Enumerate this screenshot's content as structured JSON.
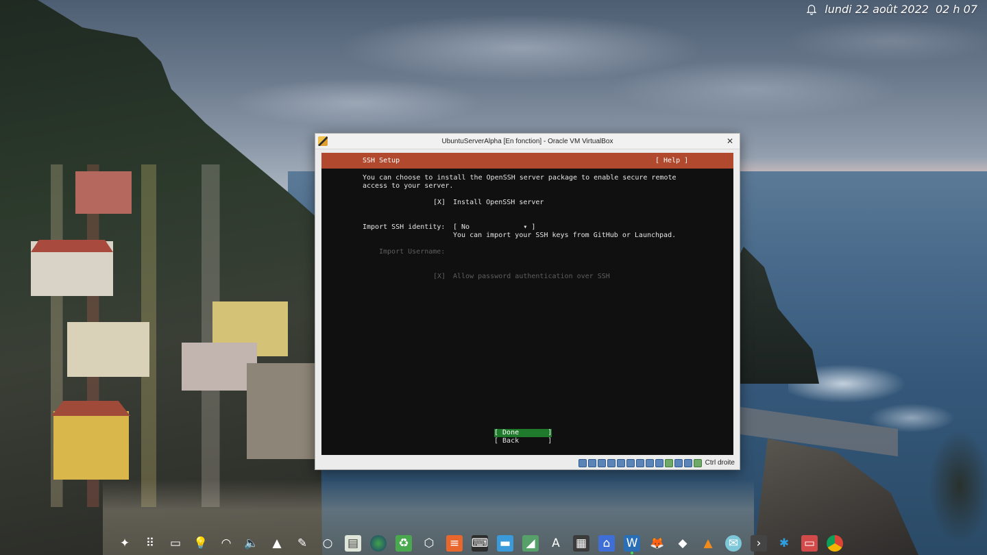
{
  "desktop": {
    "clock": {
      "date": "lundi 22 août 2022",
      "time": "02 h 07"
    }
  },
  "window": {
    "title": "UbuntuServerAlpha [En fonction] - Oracle VM VirtualBox",
    "host_key": "Ctrl droite"
  },
  "installer": {
    "header": {
      "title": "SSH Setup",
      "help": "[ Help ]"
    },
    "description_line1": "You can choose to install the OpenSSH server package to enable secure remote",
    "description_line2": "access to your server.",
    "install_openssh": {
      "checkbox": "[X]",
      "label": "Install OpenSSH server"
    },
    "import_identity": {
      "label": "Import SSH identity:",
      "value": "[ No             ▾ ]",
      "hint": "You can import your SSH keys from GitHub or Launchpad."
    },
    "import_username": {
      "label": "Import Username:"
    },
    "allow_password": {
      "checkbox": "[X]",
      "label": "Allow password authentication over SSH"
    },
    "buttons": {
      "done": "[ Done       ]",
      "back": "[ Back       ]"
    }
  },
  "colors": {
    "header_bg": "#b0492e",
    "done_bg": "#1f7a2b",
    "console_bg": "#101010"
  },
  "dock": {
    "icons": [
      "pinwheel-icon",
      "app-grid-icon",
      "desktop-icon",
      "bulb-icon",
      "wifi-icon",
      "volume-icon",
      "tray-arrow-icon",
      "pen-icon",
      "circle-icon",
      "files-icon",
      "globe-icon",
      "recycle-icon",
      "cube-icon",
      "stack-icon",
      "terminal-icon",
      "folder-icon",
      "monitor-icon",
      "font-icon",
      "calculator-icon",
      "house-icon",
      "writer-icon",
      "gimp-icon",
      "inkscape-icon",
      "vlc-icon",
      "mail-icon",
      "console-icon",
      "kodi-icon",
      "archive-icon",
      "chrome-icon"
    ]
  }
}
